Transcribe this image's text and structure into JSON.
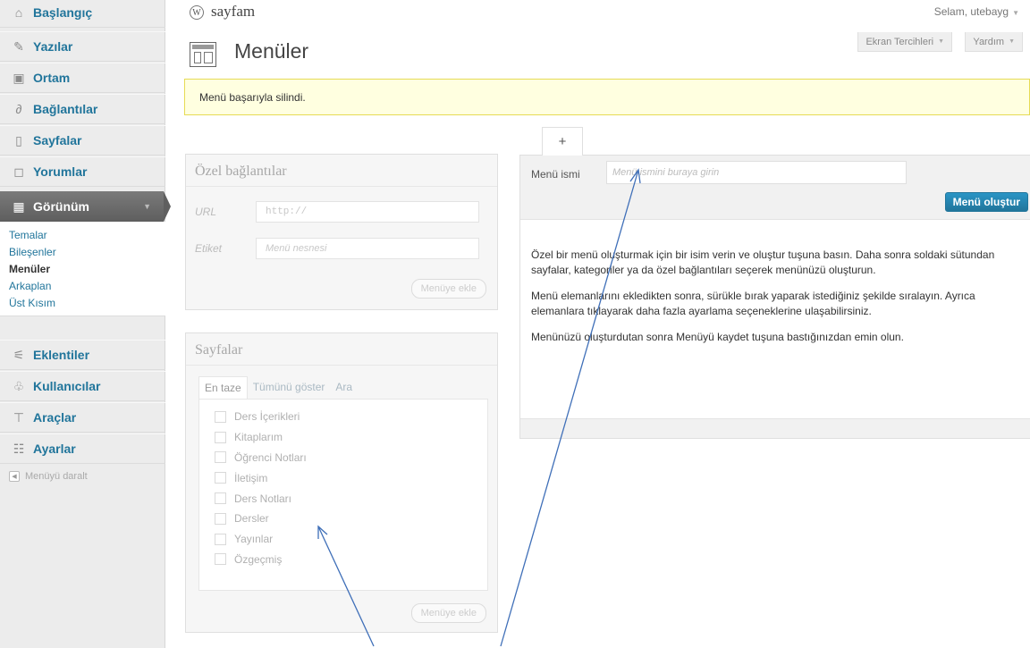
{
  "sidebar": {
    "items": [
      {
        "label": "Başlangıç",
        "icon": "dashboard-icon"
      },
      {
        "label": "Yazılar",
        "icon": "pushpin-icon"
      },
      {
        "label": "Ortam",
        "icon": "media-icon"
      },
      {
        "label": "Bağlantılar",
        "icon": "link-icon"
      },
      {
        "label": "Sayfalar",
        "icon": "pages-icon"
      },
      {
        "label": "Yorumlar",
        "icon": "comment-icon"
      },
      {
        "label": "Görünüm",
        "icon": "appearance-icon"
      },
      {
        "label": "Eklentiler",
        "icon": "plugin-icon"
      },
      {
        "label": "Kullanıcılar",
        "icon": "users-icon"
      },
      {
        "label": "Araçlar",
        "icon": "tools-icon"
      },
      {
        "label": "Ayarlar",
        "icon": "settings-icon"
      }
    ],
    "submenu": [
      "Temalar",
      "Bileşenler",
      "Menüler",
      "Arkaplan",
      "Üst Kısım"
    ],
    "collapse_label": "Menüyü daralt"
  },
  "header": {
    "site_name": "sayfam",
    "greeting": "Selam, utebayg",
    "screen_options": "Ekran Tercihleri",
    "help": "Yardım"
  },
  "page": {
    "title": "Menüler",
    "notice": "Menü başarıyla silindi."
  },
  "custom_links": {
    "title": "Özel bağlantılar",
    "url_label": "URL",
    "url_value": "http://",
    "label_label": "Etiket",
    "label_placeholder": "Menü nesnesi",
    "add_button": "Menüye ekle"
  },
  "pages_box": {
    "title": "Sayfalar",
    "tabs": [
      "En taze",
      "Tümünü göster",
      "Ara"
    ],
    "pages": [
      "Ders İçerikleri",
      "Kitaplarım",
      "Öğrenci Notları",
      "İletişim",
      "Ders Notları",
      "Dersler",
      "Yayınlar",
      "Özgeçmiş"
    ],
    "add_button": "Menüye ekle"
  },
  "menu_editor": {
    "tab_plus": "+",
    "name_label": "Menü ismi",
    "name_placeholder": "Menü ismini buraya girin",
    "create_button": "Menü oluştur",
    "instructions": [
      "Özel bir menü oluşturmak için bir isim verin ve oluştur tuşuna basın. Daha sonra soldaki sütundan sayfalar, kategoriler ya da özel bağlantıları seçerek menünüzü oluşturun.",
      "Menü elemanlarını ekledikten sonra, sürükle bırak yaparak istediğiniz şekilde sıralayın. Ayrıca elemanlara tıklayarak daha fazla ayarlama seçeneklerine ulaşabilirsiniz.",
      "Menünüzü oluşturdutan sonra Menüyü kaydet tuşuna bastığınızdan emin olun."
    ]
  },
  "colors": {
    "link_blue": "#21759b",
    "notice_bg": "#ffffe0",
    "arrow": "#3f6fb8"
  }
}
